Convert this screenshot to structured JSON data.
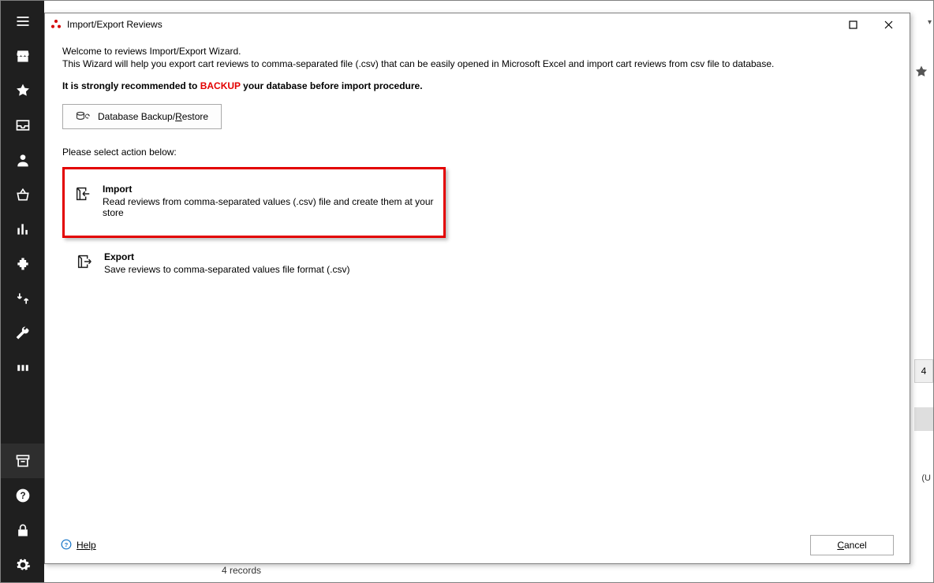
{
  "sidebar": {
    "items": [
      {
        "name": "menu-icon"
      },
      {
        "name": "store-icon"
      },
      {
        "name": "star-icon"
      },
      {
        "name": "inbox-icon"
      },
      {
        "name": "user-icon"
      },
      {
        "name": "basket-icon"
      },
      {
        "name": "chart-icon"
      },
      {
        "name": "plugin-icon"
      },
      {
        "name": "transfer-icon"
      },
      {
        "name": "wrench-icon"
      },
      {
        "name": "sync-icon"
      }
    ],
    "bottom": [
      {
        "name": "archive-icon"
      },
      {
        "name": "help-icon"
      },
      {
        "name": "lock-icon"
      },
      {
        "name": "gear-icon"
      }
    ]
  },
  "dialog": {
    "title": "Import/Export Reviews",
    "intro_line1": "Welcome to reviews Import/Export Wizard.",
    "intro_line2": "This Wizard will help you export cart reviews to comma-separated file (.csv) that can be easily opened in Microsoft Excel and import cart reviews from csv file to database.",
    "strong_prefix": "It is strongly recommended to ",
    "strong_backup": "BACKUP",
    "strong_suffix": " your database before import procedure.",
    "backup_button_prefix": "Database Backup/",
    "backup_button_hotkey": "R",
    "backup_button_suffix": "estore",
    "select_prompt": "Please select action below:",
    "import": {
      "title": "Import",
      "desc": "Read reviews from comma-separated values (.csv) file and create them at your store"
    },
    "export": {
      "title": "Export",
      "desc": "Save reviews to comma-separated values file format (.csv)"
    },
    "help_label": "Help",
    "cancel_hotkey": "C",
    "cancel_suffix": "ancel"
  },
  "background": {
    "records_label": "4 records",
    "cell_value": "4",
    "cell_text": "(U",
    "dropdown_caret": "▾"
  }
}
